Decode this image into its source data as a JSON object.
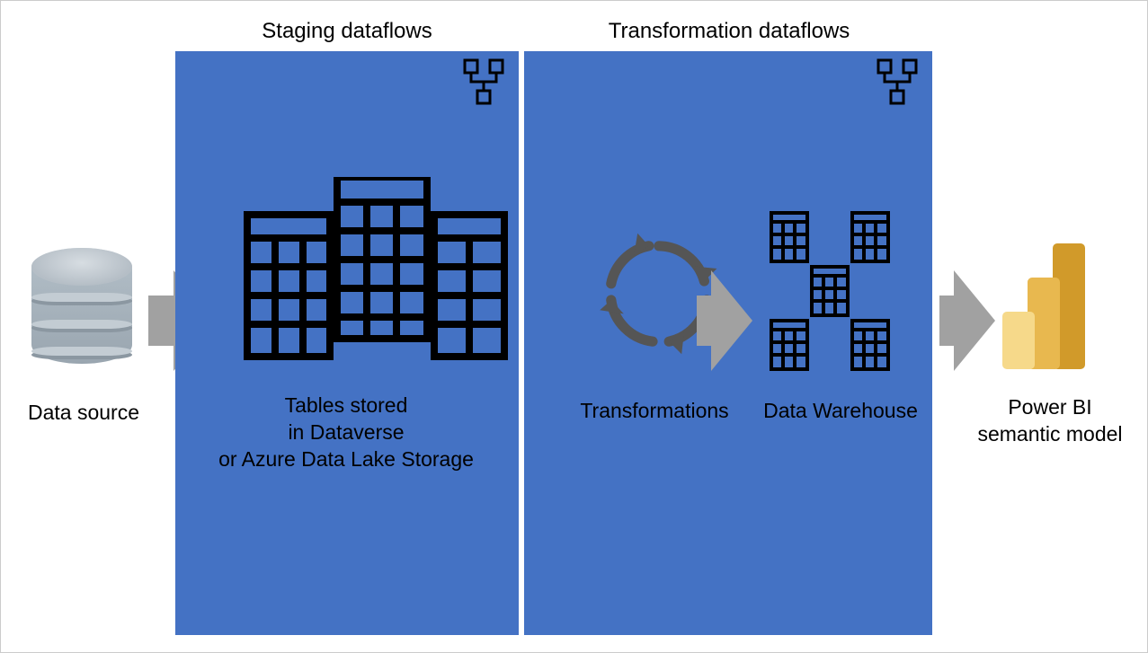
{
  "titles": {
    "staging": "Staging dataflows",
    "transformation": "Transformation dataflows"
  },
  "source": {
    "label": "Data source"
  },
  "staging": {
    "label_line1": "Tables stored",
    "label_line2": "in Dataverse",
    "label_line3": "or Azure Data Lake Storage"
  },
  "transformation": {
    "transformations_label": "Transformations",
    "warehouse_label": "Data Warehouse"
  },
  "output": {
    "label_line1": "Power BI",
    "label_line2": "semantic model"
  },
  "colors": {
    "panel": "#4472C4",
    "arrow": "#A1A1A1",
    "powerbi_light": "#F6D98A",
    "powerbi_mid": "#E8B84F",
    "powerbi_dark": "#D19A2A"
  }
}
